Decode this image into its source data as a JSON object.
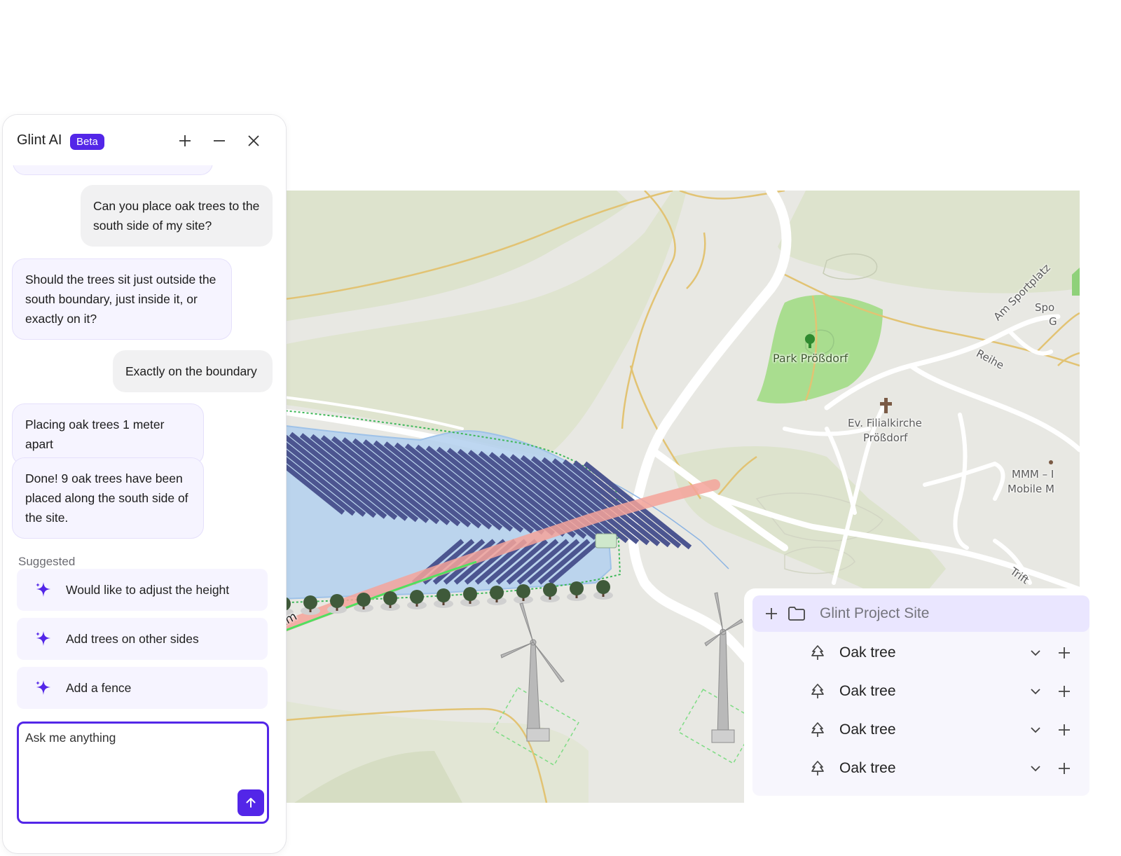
{
  "chat": {
    "title": "Glint AI",
    "badge": "Beta",
    "messages": [
      {
        "role": "user",
        "text": "Can you place oak trees to the south side of my site?"
      },
      {
        "role": "assistant",
        "text": "Should the trees sit just outside the south boundary, just inside it, or exactly on it?"
      },
      {
        "role": "user",
        "text": "Exactly on the boundary"
      },
      {
        "role": "assistant",
        "text": "Placing oak trees 1 meter apart"
      },
      {
        "role": "assistant",
        "text": "Done! 9 oak trees have been placed along the south side of the site."
      }
    ],
    "suggested_label": "Suggested",
    "suggestions": [
      "Would like to adjust the height",
      "Add trees on other sides",
      "Add a fence"
    ],
    "input_placeholder": "Ask me anything",
    "accent_color": "#5326e8"
  },
  "map": {
    "labels": {
      "park": "Park Prößdorf",
      "church_line1": "Ev. Filialkirche",
      "church_line2": "Prößdorf",
      "street_sportplatz": "Am Sportplatz",
      "street_reihe": "Reihe",
      "street_trift": "Trift",
      "poi_spo": "Spo",
      "poi_g": "G",
      "poi_mmm": "MMM – I",
      "poi_mobile": "Mobile M",
      "distance": "km"
    }
  },
  "layers": {
    "root": "Glint Project Site",
    "items": [
      "Oak tree",
      "Oak tree",
      "Oak tree",
      "Oak tree"
    ]
  }
}
